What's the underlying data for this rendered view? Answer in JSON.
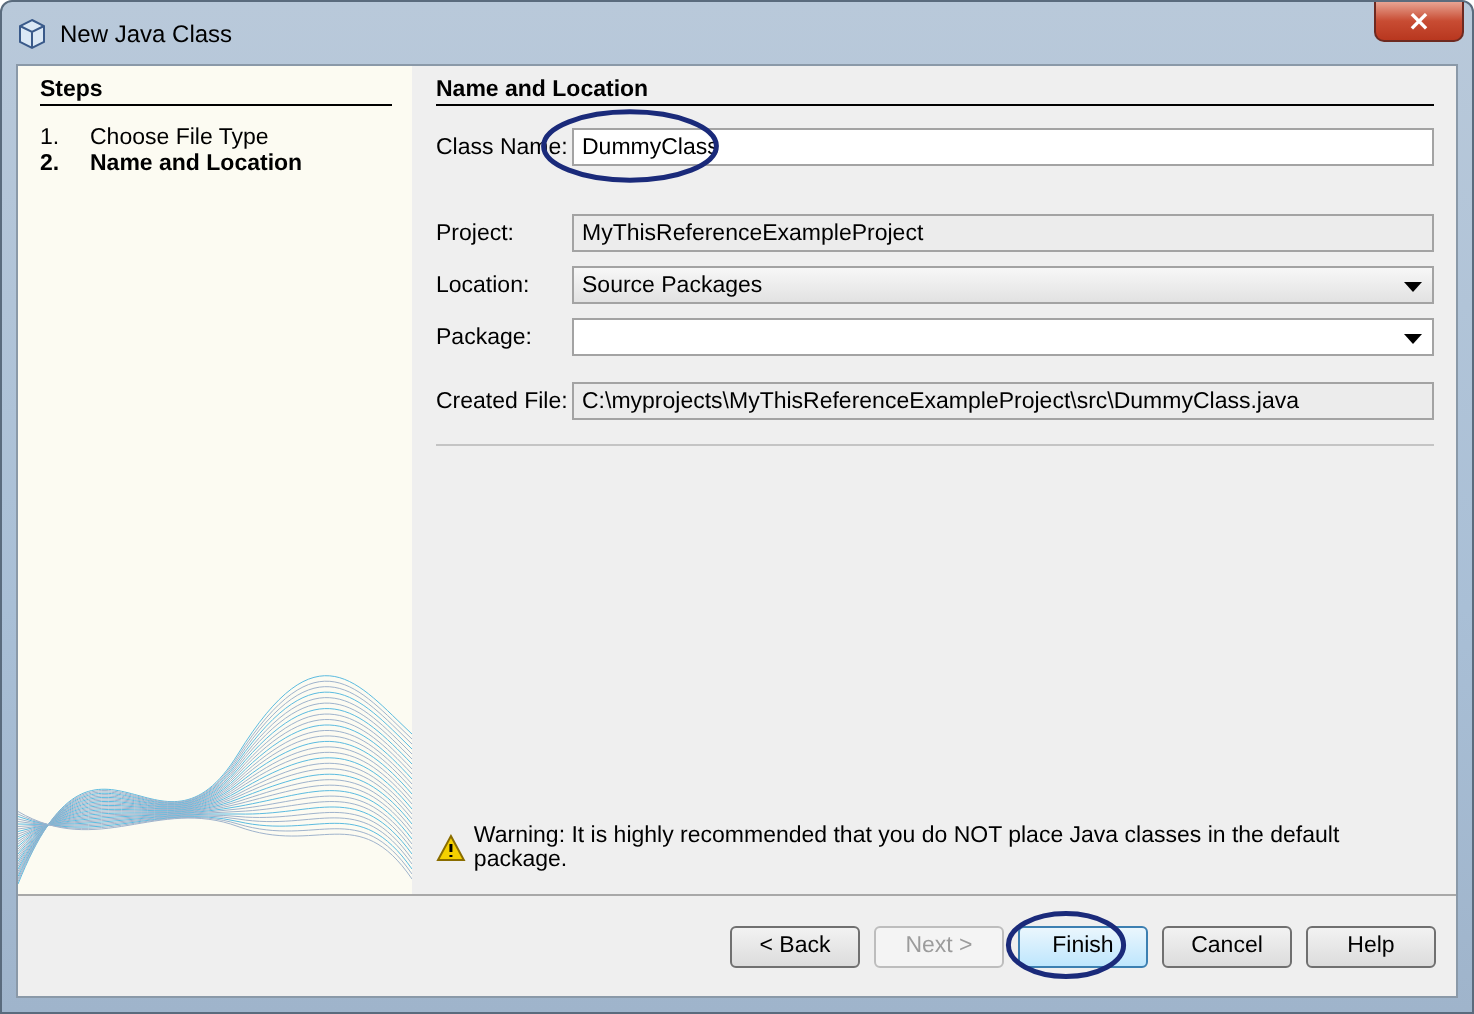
{
  "window": {
    "title": "New Java Class",
    "close": "×"
  },
  "steps": {
    "title": "Steps",
    "items": [
      {
        "number": "1.",
        "label": "Choose File Type",
        "selected": false
      },
      {
        "number": "2.",
        "label": "Name and Location",
        "selected": true
      }
    ]
  },
  "panel": {
    "title": "Name and Location",
    "class_name": {
      "label": "Class Name:",
      "value": "DummyClass",
      "circled": true
    },
    "fields": [
      {
        "kind": "readonly",
        "label": "Project:",
        "value": "MyThisReferenceExampleProject"
      },
      {
        "kind": "combo",
        "label": "Location:",
        "value": "Source Packages"
      },
      {
        "kind": "editable-combo",
        "label": "Package:"
      },
      {
        "kind": "readonly",
        "label": "Created File:",
        "value": "C:\\myprojects\\MyThisReferenceExampleProject\\src\\DummyClass.java"
      }
    ],
    "warning": "Warning: It is highly recommended that you do NOT place Java classes in the default package."
  },
  "buttons": [
    {
      "label": "< Back",
      "disabled": false,
      "focused": false,
      "circled": false
    },
    {
      "label": "Next >",
      "disabled": true,
      "focused": false,
      "circled": false
    },
    {
      "label": "Finish",
      "disabled": false,
      "focused": true,
      "circled": true
    },
    {
      "label": "Cancel",
      "disabled": false,
      "focused": false,
      "circled": false
    },
    {
      "label": "Help",
      "disabled": false,
      "focused": false,
      "circled": false
    }
  ]
}
